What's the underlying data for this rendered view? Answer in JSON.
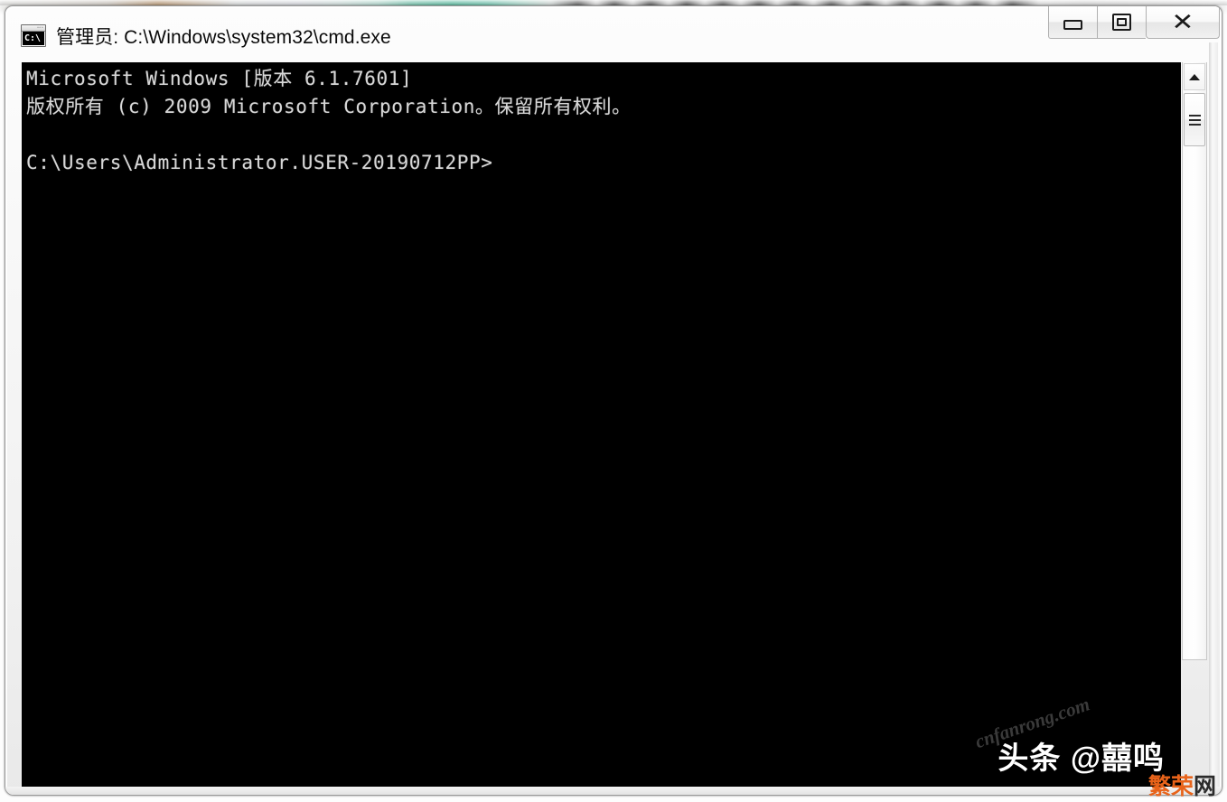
{
  "window": {
    "title": "管理员: C:\\Windows\\system32\\cmd.exe",
    "icon_name": "cmd-icon",
    "icon_text": "C:\\",
    "controls": {
      "minimize_label": "最小化",
      "maximize_label": "最大化",
      "close_label": "✕"
    }
  },
  "console": {
    "lines": [
      "Microsoft Windows [版本 6.1.7601]",
      "版权所有 (c) 2009 Microsoft Corporation。保留所有权利。",
      "",
      "C:\\Users\\Administrator.USER-20190712PP>"
    ],
    "text": "Microsoft Windows [版本 6.1.7601]\n版权所有 (c) 2009 Microsoft Corporation。保留所有权利。\n\nC:\\Users\\Administrator.USER-20190712PP>",
    "background_color": "#000000",
    "foreground_color": "#d8d8d8",
    "prompt": "C:\\Users\\Administrator.USER-20190712PP>"
  },
  "scrollbar": {
    "up_arrow": "▲",
    "position_percent": 0
  },
  "watermarks": {
    "site": "cnfanrong.com",
    "author": "头条 @囍鸣",
    "badge_primary": "繁荣",
    "badge_secondary": "网",
    "badge_primary_color": "#e8631a",
    "badge_secondary_color": "#2b2b2b"
  }
}
